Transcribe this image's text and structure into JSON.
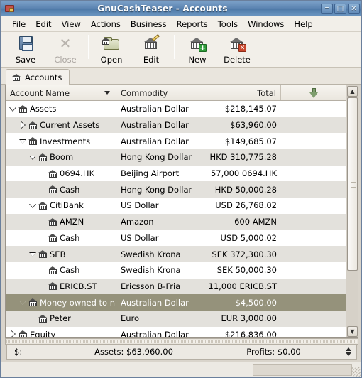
{
  "window": {
    "title": "GnuCashTeaser - Accounts",
    "app_icon": "wallet-icon",
    "buttons": {
      "minimize": "–",
      "maximize": "□",
      "close": "✕"
    }
  },
  "menubar": {
    "items": [
      {
        "label": "File",
        "mnemonic": "F"
      },
      {
        "label": "Edit",
        "mnemonic": "E"
      },
      {
        "label": "View",
        "mnemonic": "V"
      },
      {
        "label": "Actions",
        "mnemonic": "A"
      },
      {
        "label": "Business",
        "mnemonic": "B"
      },
      {
        "label": "Reports",
        "mnemonic": "R"
      },
      {
        "label": "Tools",
        "mnemonic": "T"
      },
      {
        "label": "Windows",
        "mnemonic": "W"
      },
      {
        "label": "Help",
        "mnemonic": "H"
      }
    ]
  },
  "toolbar": {
    "save_label": "Save",
    "close_label": "Close",
    "open_label": "Open",
    "edit_label": "Edit",
    "new_label": "New",
    "delete_label": "Delete"
  },
  "tab": {
    "label": "Accounts",
    "icon": "bank-icon"
  },
  "columns": {
    "name": "Account Name",
    "commodity": "Commodity",
    "total": "Total",
    "chooser_icon": "green-down-arrow-icon"
  },
  "rows": [
    {
      "name": "Assets",
      "commodity": "Australian Dollar",
      "total": "$218,145.07",
      "depth": 0,
      "expander": "open",
      "selected": false
    },
    {
      "name": "Current Assets",
      "commodity": "Australian Dollar",
      "total": "$63,960.00",
      "depth": 1,
      "expander": "closed",
      "selected": false
    },
    {
      "name": "Investments",
      "commodity": "Australian Dollar",
      "total": "$149,685.07",
      "depth": 1,
      "expander": "open",
      "selected": false
    },
    {
      "name": "Boom",
      "commodity": "Hong Kong Dollar",
      "total": "HKD 310,775.28",
      "depth": 2,
      "expander": "open",
      "selected": false
    },
    {
      "name": "0694.HK",
      "commodity": "Beijing Airport",
      "total": "57,000 0694.HK",
      "depth": 3,
      "expander": "none",
      "selected": false
    },
    {
      "name": "Cash",
      "commodity": "Hong Kong Dollar",
      "total": "HKD 50,000.28",
      "depth": 3,
      "expander": "none",
      "selected": false
    },
    {
      "name": "CitiBank",
      "commodity": "US Dollar",
      "total": "USD 26,768.02",
      "depth": 2,
      "expander": "open",
      "selected": false
    },
    {
      "name": "AMZN",
      "commodity": "Amazon",
      "total": "600 AMZN",
      "depth": 3,
      "expander": "none",
      "selected": false
    },
    {
      "name": "Cash",
      "commodity": "US Dollar",
      "total": "USD 5,000.02",
      "depth": 3,
      "expander": "none",
      "selected": false
    },
    {
      "name": "SEB",
      "commodity": "Swedish Krona",
      "total": "SEK 372,300.30",
      "depth": 2,
      "expander": "open",
      "selected": false
    },
    {
      "name": "Cash",
      "commodity": "Swedish Krona",
      "total": "SEK 50,000.30",
      "depth": 3,
      "expander": "none",
      "selected": false
    },
    {
      "name": "ERICB.ST",
      "commodity": "Ericsson B-Fria",
      "total": "11,000 ERICB.ST",
      "depth": 3,
      "expander": "none",
      "selected": false
    },
    {
      "name": "Money owned to n",
      "commodity": "Australian Dollar",
      "total": "$4,500.00",
      "depth": 1,
      "expander": "open",
      "selected": true
    },
    {
      "name": "Peter",
      "commodity": "Euro",
      "total": "EUR 3,000.00",
      "depth": 2,
      "expander": "none",
      "selected": false
    },
    {
      "name": "Equity",
      "commodity": "Australian Dollar",
      "total": "$216,836.00",
      "depth": 0,
      "expander": "closed",
      "selected": false
    }
  ],
  "summary": {
    "currency": "$:",
    "assets": "Assets: $63,960.00",
    "profits": "Profits: $0.00"
  },
  "scrollbar": {
    "up_glyph": "▲",
    "down_glyph": "▼"
  }
}
